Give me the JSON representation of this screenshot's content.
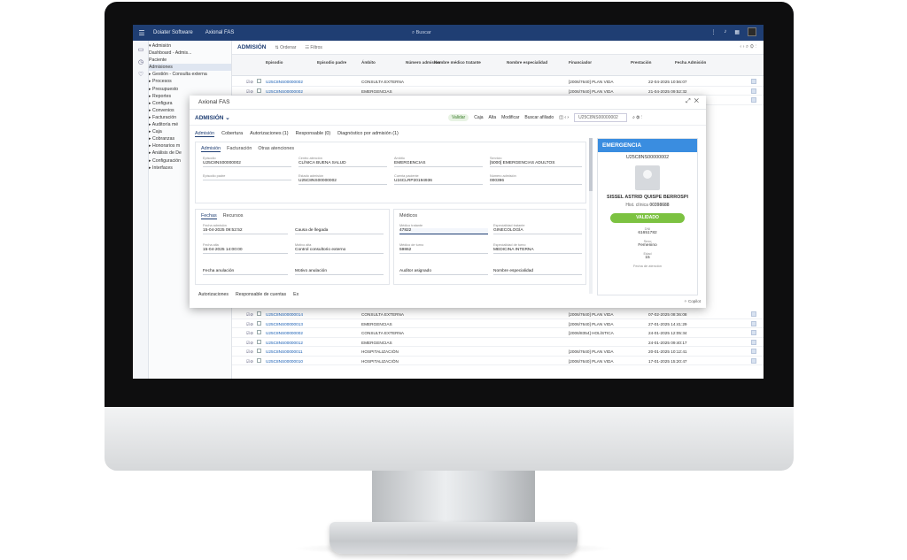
{
  "topbar": {
    "brand": "Doiater Software",
    "app": "Axional FAS",
    "search_placeholder": "Buscar",
    "menu_icon": "menu-icon"
  },
  "tree": {
    "items": [
      {
        "label": "▾ Admisión"
      },
      {
        "label": "   Dashboard - Admis..."
      },
      {
        "label": "   Paciente"
      },
      {
        "label": "   Admisiones"
      },
      {
        "label": "▸ Gestión - Consulta externa"
      },
      {
        "label": "▸ Procesos"
      },
      {
        "label": "▸ Presupuesto"
      },
      {
        "label": "▸ Reportes"
      },
      {
        "label": "▸ Configura"
      },
      {
        "label": "▸ Convenios"
      },
      {
        "label": "▸ Facturación"
      },
      {
        "label": "▸ Auditoría mé"
      },
      {
        "label": "▸ Caja"
      },
      {
        "label": "▸ Cobranzas"
      },
      {
        "label": "▸ Honorarios m"
      },
      {
        "label": "▸ Análisis de De"
      },
      {
        "label": "▸ Configuración"
      },
      {
        "label": "▸ Interfaces"
      }
    ]
  },
  "content": {
    "title": "ADMISIÓN",
    "order_label": "Ordenar",
    "filter_label": "Filtros"
  },
  "grid": {
    "headers": [
      "Episodio",
      "Episodio padre",
      "Ámbito",
      "Número admisión",
      "Nombre médico tratante",
      "Nombre especialidad",
      "Financiador",
      "Prestación",
      "Fecha Admisión"
    ],
    "rows_top": [
      {
        "ep": "U25C8NS00000002",
        "amb": "CONSULTA EXTERNA",
        "fin": "[2006/7640] PLAN VIDA",
        "dt": "22-04-2025 10:56:07"
      },
      {
        "ep": "U25C8NS00000002",
        "amb": "EMERGENCIAS",
        "fin": "[2006/7640] PLAN VIDA",
        "dt": "21-04-2025 09:52:32"
      },
      {
        "ep": "U25C8NS00000002",
        "amb": "EMERGENCIAS",
        "fin": "[2006/7640] PLAN VIDA",
        "dt": "17-04-2025 12:55:09"
      }
    ],
    "rows_bottom": [
      {
        "ep": "U25C8NS00000014",
        "amb": "CONSULTA EXTERNA",
        "med": "",
        "fin": "[2006/7640] PLAN VIDA",
        "dt": "07-02-2025 08:36:08"
      },
      {
        "ep": "U25C8NS00000013",
        "amb": "EMERGENCIAS",
        "med": "",
        "fin": "[2006/7640] PLAN VIDA",
        "dt": "27-01-2025 14:41:29"
      },
      {
        "ep": "U25C8NS00000002",
        "amb": "CONSULTA EXTERNA",
        "med": "",
        "fin": "[2006/8354] HOLÍSTICA",
        "dt": "24-01-2025 12:05:34"
      },
      {
        "ep": "U25C8NS00000012",
        "amb": "EMERGENCIAS",
        "med": "",
        "fin": "",
        "dt": "24-01-2025 09:40:17"
      },
      {
        "ep": "U25C8NS00000011",
        "amb": "HOSPITALIZACIÓN",
        "med": "",
        "fin": "[2006/7640] PLAN VIDA",
        "dt": "20-01-2025 10:12:41"
      },
      {
        "ep": "U25C8NS00000010",
        "amb": "HOSPITALIZACIÓN",
        "med": "",
        "fin": "[2006/7640] PLAN VIDA",
        "dt": "17-01-2025 15:20:47"
      }
    ]
  },
  "modal": {
    "title": "Axional FAS",
    "section": "ADMISIÓN",
    "actions": [
      "Validar",
      "Caja",
      "Alta",
      "Modificar",
      "Buscar afiliado"
    ],
    "episode_box": "U25C8NS00000002",
    "tabs": [
      "Admisión",
      "Cobertura",
      "Autorizaciones (1)",
      "Responsable (0)",
      "Diagnóstico por admisión (1)"
    ],
    "subtabs": [
      "Admisión",
      "Facturación",
      "Otras atenciones"
    ],
    "fields": {
      "episodio": {
        "label": "Episodio",
        "value": "U25C8NS00000002"
      },
      "centro": {
        "label": "Centro atención",
        "value": "CLÍNICA BUENA SALUD"
      },
      "ambito": {
        "label": "Ámbito",
        "value": "EMERGENCIAS"
      },
      "servicio": {
        "label": "Servicio",
        "value": "[5000] EMERGENCIAS ADULTOS"
      },
      "padre": {
        "label": "Episodio padre",
        "value": "U25C8NS00000002"
      },
      "estado": {
        "label": "Estado admisión",
        "value": ""
      },
      "cuenta": {
        "label": "Cuenta paciente",
        "value": "U24CLRP20194936"
      },
      "numadm": {
        "label": "Número admisión",
        "value": "000396"
      }
    },
    "fechas_tabs": [
      "Fechas",
      "Recursos"
    ],
    "fechas": {
      "f1": {
        "label": "Fecha admisión",
        "value": "15-04-2025 09:52:52"
      },
      "f2": {
        "label": "Fecha alta",
        "value": "15-04-2025 14:00:00"
      },
      "f3": {
        "label": "",
        "value": "Fecha anulación"
      },
      "r1": {
        "label": "",
        "value": "Causa de llegada"
      },
      "r2": {
        "label": "Motivo alta",
        "value": "Control consultorio externo"
      },
      "r3": {
        "label": "",
        "value": "Motivo anulación"
      }
    },
    "medicos_title": "Médicos",
    "medicos": {
      "m1": {
        "label": "Médico tratante",
        "value": "47822"
      },
      "m2": {
        "label": "Especialidad tratante",
        "value": "GINECOLOGÍA"
      },
      "m3": {
        "label": "Médico de turno",
        "value": "59862"
      },
      "m4": {
        "label": "Especialidad de turno",
        "value": "MEDICINA INTERNA"
      },
      "m5": {
        "label": "",
        "value": "Auditor asignado"
      },
      "m6": {
        "label": "",
        "value": "Nombre especialidad"
      }
    },
    "bottom_tabs": [
      "Autorizaciones",
      "Responsable de cuentas",
      "Ex"
    ],
    "copilot": "Copilot"
  },
  "card": {
    "header": "EMERGENCIA",
    "code": "U25C8NS00000002",
    "name": "SISSEL ASTRID QUISPE BERROSPI",
    "hist_label": "Hist. clínica",
    "hist_value": "00398688",
    "valid": "VALIDADO",
    "dni_label": "DNI",
    "dni": "61651782",
    "sexo_label": "Sexo",
    "sexo": "Femenino",
    "edad_label": "Edad",
    "edad": "15",
    "fecha_label": "Fecha de atención",
    "accent": "#3a8de0",
    "valid_color": "#7cc241"
  }
}
